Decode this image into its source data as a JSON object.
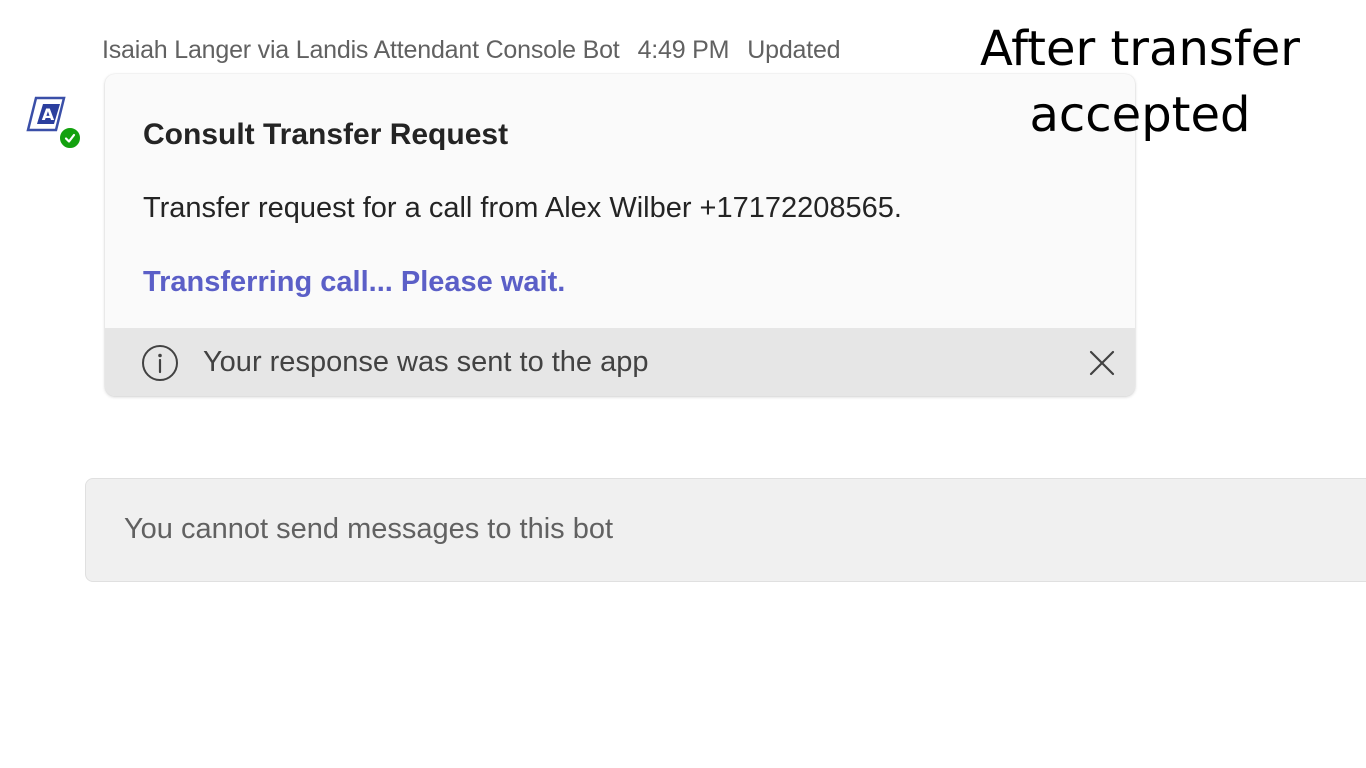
{
  "message": {
    "sender": "Isaiah Langer via Landis Attendant Console Bot",
    "time": "4:49 PM",
    "edited_label": "Updated"
  },
  "card": {
    "title": "Consult Transfer Request",
    "body": "Transfer request for a call from Alex Wilber +17172208565.",
    "status": "Transferring call... Please wait.",
    "footer_text": "Your response was sent to the app"
  },
  "annotation": {
    "line1": "After transfer",
    "line2": "accepted"
  },
  "compose": {
    "disabled_text": "You cannot send messages to this bot"
  },
  "icons": {
    "avatar": "bot-logo-icon",
    "presence": "available-check-icon",
    "info": "info-icon",
    "close": "close-icon"
  },
  "colors": {
    "accent": "#5b5fc7",
    "presence": "#13a10e",
    "footer_bg": "#e6e6e6",
    "card_bg": "#fafafa",
    "compose_bg": "#f0f0f0"
  }
}
